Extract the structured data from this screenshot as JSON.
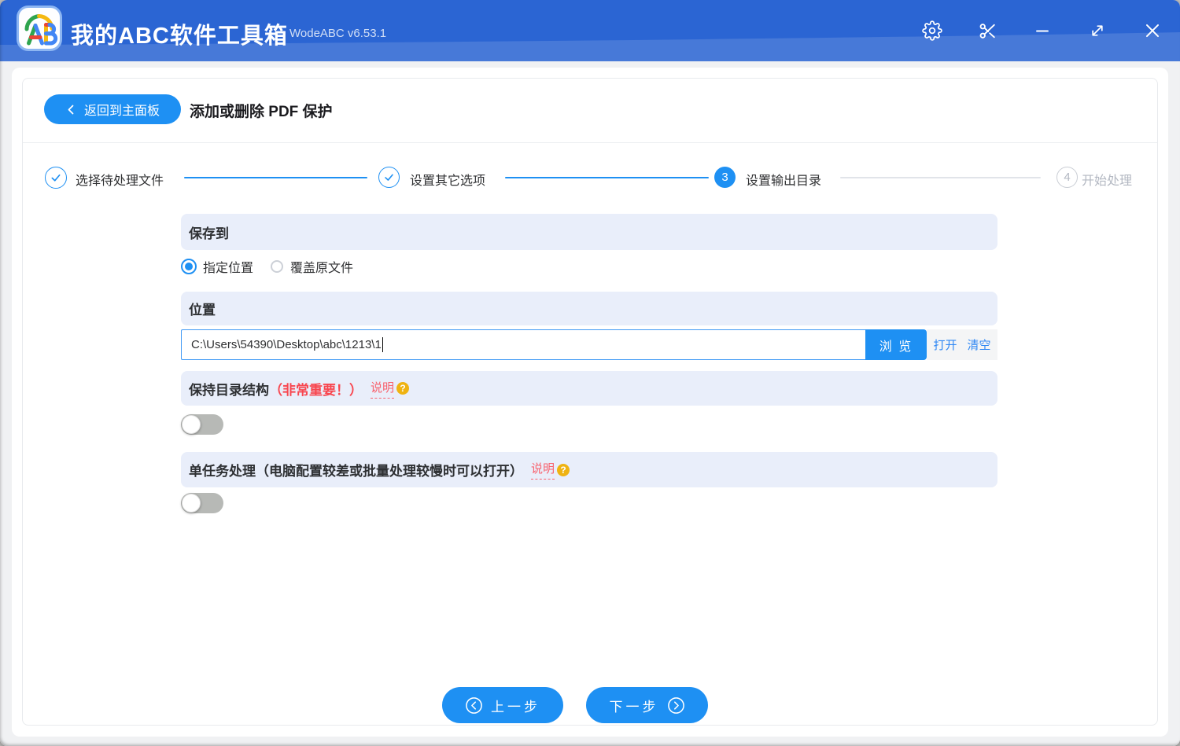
{
  "window": {
    "title": "我的ABC软件工具箱",
    "version": "WodeABC v6.53.1"
  },
  "toolbar": {
    "back_label": "返回到主面板",
    "page_title": "添加或删除 PDF 保护"
  },
  "stepper": {
    "steps": [
      {
        "number": "1",
        "label": "选择待处理文件",
        "state": "done"
      },
      {
        "number": "2",
        "label": "设置其它选项",
        "state": "done"
      },
      {
        "number": "3",
        "label": "设置输出目录",
        "state": "current"
      },
      {
        "number": "4",
        "label": "开始处理",
        "state": "pending"
      }
    ]
  },
  "form": {
    "save_to": {
      "title": "保存到",
      "options": [
        {
          "label": "指定位置",
          "selected": true
        },
        {
          "label": "覆盖原文件",
          "selected": false
        }
      ]
    },
    "location": {
      "title": "位置",
      "value": "C:\\Users\\54390\\Desktop\\abc\\1213\\1",
      "browse_label": "浏 览",
      "open_label": "打开",
      "clear_label": "清空"
    },
    "keep_structure": {
      "title": "保持目录结构",
      "important": "（非常重要！）",
      "help_label": "说明",
      "enabled": false
    },
    "single_task": {
      "title": "单任务处理（电脑配置较差或批量处理较慢时可以打开）",
      "help_label": "说明",
      "enabled": false
    }
  },
  "icons": {
    "question_mark": "?"
  },
  "footer": {
    "prev_label": "上一步",
    "next_label": "下一步"
  },
  "colors": {
    "titlebar": "#2b65d3",
    "accent": "#1e90f3",
    "section_bg": "#e9eefa",
    "danger": "#f8464f",
    "help_gold": "#efb312"
  }
}
